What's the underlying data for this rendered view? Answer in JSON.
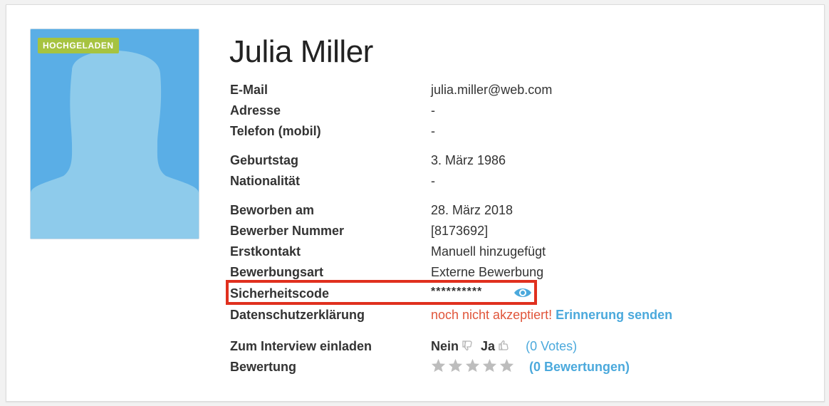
{
  "profile": {
    "name": "Julia Miller",
    "badge": "HOCHGELADEN"
  },
  "fields": {
    "email_label": "E-Mail",
    "email_value": "julia.miller@web.com",
    "address_label": "Adresse",
    "address_value": "-",
    "phone_label": "Telefon (mobil)",
    "phone_value": "-",
    "birthday_label": "Geburtstag",
    "birthday_value": "3. März 1986",
    "nationality_label": "Nationalität",
    "nationality_value": "-",
    "applied_label": "Beworben am",
    "applied_value": "28. März 2018",
    "applicant_number_label": "Bewerber Nummer",
    "applicant_number_value": "[8173692]",
    "first_contact_label": "Erstkontakt",
    "first_contact_value": "Manuell hinzugefügt",
    "application_type_label": "Bewerbungsart",
    "application_type_value": "Externe Bewerbung",
    "security_code_label": "Sicherheitscode",
    "security_code_value": "**********",
    "privacy_label": "Datenschutzerklärung",
    "privacy_status": "noch nicht akzeptiert!",
    "privacy_reminder_link": "Erinnerung senden",
    "invite_label": "Zum Interview einladen",
    "invite_no": "Nein",
    "invite_yes": "Ja",
    "invite_votes": "(0 Votes)",
    "rating_label": "Bewertung",
    "rating_count": "(0 Bewertungen)"
  },
  "rating": {
    "value": 0,
    "max": 5
  },
  "icons": {
    "eye": "eye-icon",
    "thumbs_down": "thumbs-down-icon",
    "thumbs_up": "thumbs-up-icon",
    "star": "star-icon"
  },
  "colors": {
    "badge": "#a6c340",
    "link": "#4ba9dc",
    "warning": "#e0553a",
    "highlight": "#e0301e",
    "avatar_bg": "#5aaee6",
    "avatar_silhouette": "#8ecbeb",
    "star_empty": "#bdbdbd"
  }
}
